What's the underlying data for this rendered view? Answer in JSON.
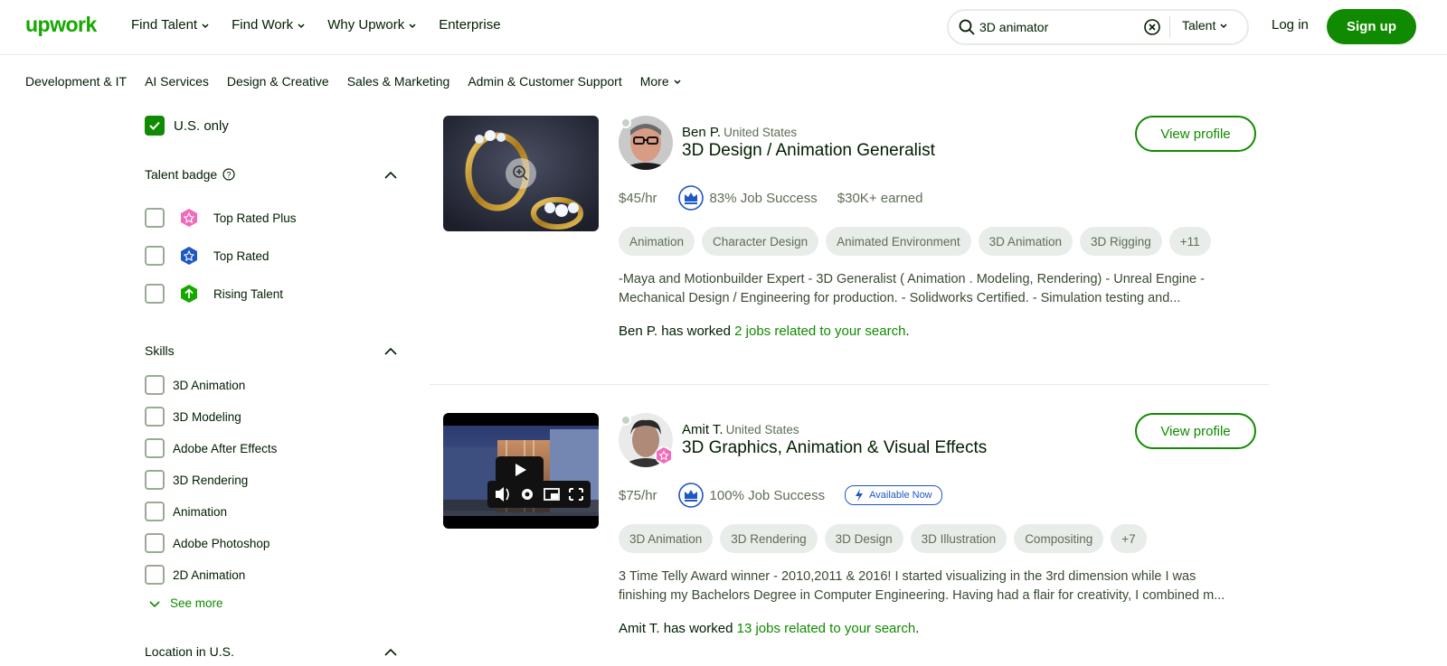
{
  "header": {
    "logo": "upwork",
    "nav": [
      "Find Talent",
      "Find Work",
      "Why Upwork",
      "Enterprise"
    ],
    "search_value": "3D animator",
    "search_scope": "Talent",
    "login": "Log in",
    "signup": "Sign up"
  },
  "categories": {
    "items": [
      "Development & IT",
      "AI Services",
      "Design & Creative",
      "Sales & Marketing",
      "Admin & Customer Support"
    ],
    "more": "More"
  },
  "sidebar": {
    "us_only": "U.S. only",
    "talent_badge_title": "Talent badge",
    "badges": [
      "Top Rated Plus",
      "Top Rated",
      "Rising Talent"
    ],
    "skills_title": "Skills",
    "skills": [
      "3D Animation",
      "3D Modeling",
      "Adobe After Effects",
      "3D Rendering",
      "Animation",
      "Adobe Photoshop",
      "2D Animation"
    ],
    "see_more": "See more",
    "location_title": "Location in U.S."
  },
  "cards": [
    {
      "name": "Ben P.",
      "country": "United States",
      "title": "3D Design / Animation Generalist",
      "rate": "$45/hr",
      "job_success": "83% Job Success",
      "earned": "$30K+ earned",
      "tags": [
        "Animation",
        "Character Design",
        "Animated Environment",
        "3D Animation",
        "3D Rigging",
        "+11"
      ],
      "desc1": "-Maya and Motionbuilder Expert - 3D Generalist ( Animation . Modeling, Rendering) - Unreal Engine -",
      "desc2": "Mechanical Design / Engineering for production. - Solidworks Certified. - Simulation testing and...",
      "worked_prefix": "Ben P. has worked ",
      "worked_link": "2 jobs related to your search",
      "worked_suffix": ".",
      "view_profile": "View profile"
    },
    {
      "name": "Amit T.",
      "country": "United States",
      "title": "3D Graphics, Animation & Visual Effects",
      "rate": "$75/hr",
      "job_success": "100% Job Success",
      "available": "Available Now",
      "tags": [
        "3D Animation",
        "3D Rendering",
        "3D Design",
        "3D Illustration",
        "Compositing",
        "+7"
      ],
      "desc1": "3 Time Telly Award winner - 2010,2011 & 2016! I started visualizing in the 3rd dimension while I was",
      "desc2": "finishing my Bachelors Degree in Computer Engineering. Having had a flair for creativity, I combined m...",
      "worked_prefix": "Amit T. has worked ",
      "worked_link": "13 jobs related to your search",
      "worked_suffix": ".",
      "view_profile": "View profile"
    }
  ],
  "colors": {
    "brand_green": "#108a00",
    "logo_green": "#14a800",
    "blue_badge": "#1f57c3",
    "pink_badge": "#f06bb9"
  }
}
